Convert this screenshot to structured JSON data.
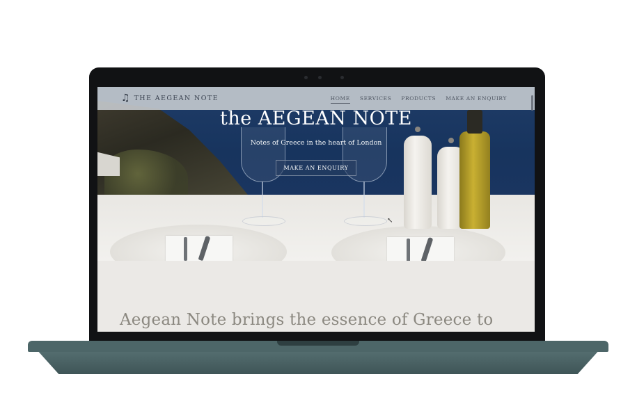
{
  "site": {
    "logo_text": "THE AEGEAN NOTE",
    "logo_icon": "music-note-icon"
  },
  "nav": {
    "items": [
      {
        "label": "HOME",
        "active": true
      },
      {
        "label": "SERVICES",
        "active": false
      },
      {
        "label": "PRODUCTS",
        "active": false
      },
      {
        "label": "MAKE AN ENQUIRY",
        "active": false
      }
    ]
  },
  "hero": {
    "title": "the AEGEAN NOTE",
    "subtitle": "Notes of Greece in the heart of London",
    "cta_label": "MAKE AN ENQUIRY"
  },
  "intro": {
    "text": "Aegean Note brings the essence of Greece to"
  },
  "colors": {
    "nav_bg": "#cacdd3",
    "sea": "#1f3c67",
    "page_bg": "#ebe9e6",
    "laptop_base": "#4d6668"
  }
}
